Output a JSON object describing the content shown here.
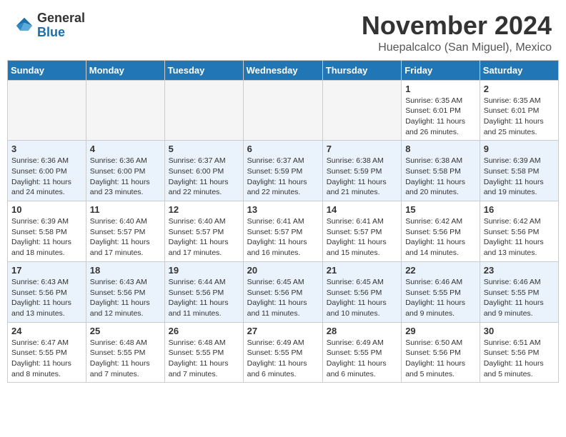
{
  "header": {
    "logo_general": "General",
    "logo_blue": "Blue",
    "month": "November 2024",
    "location": "Huepalcalco (San Miguel), Mexico"
  },
  "days_of_week": [
    "Sunday",
    "Monday",
    "Tuesday",
    "Wednesday",
    "Thursday",
    "Friday",
    "Saturday"
  ],
  "weeks": [
    [
      {
        "day": "",
        "info": ""
      },
      {
        "day": "",
        "info": ""
      },
      {
        "day": "",
        "info": ""
      },
      {
        "day": "",
        "info": ""
      },
      {
        "day": "",
        "info": ""
      },
      {
        "day": "1",
        "info": "Sunrise: 6:35 AM\nSunset: 6:01 PM\nDaylight: 11 hours and 26 minutes."
      },
      {
        "day": "2",
        "info": "Sunrise: 6:35 AM\nSunset: 6:01 PM\nDaylight: 11 hours and 25 minutes."
      }
    ],
    [
      {
        "day": "3",
        "info": "Sunrise: 6:36 AM\nSunset: 6:00 PM\nDaylight: 11 hours and 24 minutes."
      },
      {
        "day": "4",
        "info": "Sunrise: 6:36 AM\nSunset: 6:00 PM\nDaylight: 11 hours and 23 minutes."
      },
      {
        "day": "5",
        "info": "Sunrise: 6:37 AM\nSunset: 6:00 PM\nDaylight: 11 hours and 22 minutes."
      },
      {
        "day": "6",
        "info": "Sunrise: 6:37 AM\nSunset: 5:59 PM\nDaylight: 11 hours and 22 minutes."
      },
      {
        "day": "7",
        "info": "Sunrise: 6:38 AM\nSunset: 5:59 PM\nDaylight: 11 hours and 21 minutes."
      },
      {
        "day": "8",
        "info": "Sunrise: 6:38 AM\nSunset: 5:58 PM\nDaylight: 11 hours and 20 minutes."
      },
      {
        "day": "9",
        "info": "Sunrise: 6:39 AM\nSunset: 5:58 PM\nDaylight: 11 hours and 19 minutes."
      }
    ],
    [
      {
        "day": "10",
        "info": "Sunrise: 6:39 AM\nSunset: 5:58 PM\nDaylight: 11 hours and 18 minutes."
      },
      {
        "day": "11",
        "info": "Sunrise: 6:40 AM\nSunset: 5:57 PM\nDaylight: 11 hours and 17 minutes."
      },
      {
        "day": "12",
        "info": "Sunrise: 6:40 AM\nSunset: 5:57 PM\nDaylight: 11 hours and 17 minutes."
      },
      {
        "day": "13",
        "info": "Sunrise: 6:41 AM\nSunset: 5:57 PM\nDaylight: 11 hours and 16 minutes."
      },
      {
        "day": "14",
        "info": "Sunrise: 6:41 AM\nSunset: 5:57 PM\nDaylight: 11 hours and 15 minutes."
      },
      {
        "day": "15",
        "info": "Sunrise: 6:42 AM\nSunset: 5:56 PM\nDaylight: 11 hours and 14 minutes."
      },
      {
        "day": "16",
        "info": "Sunrise: 6:42 AM\nSunset: 5:56 PM\nDaylight: 11 hours and 13 minutes."
      }
    ],
    [
      {
        "day": "17",
        "info": "Sunrise: 6:43 AM\nSunset: 5:56 PM\nDaylight: 11 hours and 13 minutes."
      },
      {
        "day": "18",
        "info": "Sunrise: 6:43 AM\nSunset: 5:56 PM\nDaylight: 11 hours and 12 minutes."
      },
      {
        "day": "19",
        "info": "Sunrise: 6:44 AM\nSunset: 5:56 PM\nDaylight: 11 hours and 11 minutes."
      },
      {
        "day": "20",
        "info": "Sunrise: 6:45 AM\nSunset: 5:56 PM\nDaylight: 11 hours and 11 minutes."
      },
      {
        "day": "21",
        "info": "Sunrise: 6:45 AM\nSunset: 5:56 PM\nDaylight: 11 hours and 10 minutes."
      },
      {
        "day": "22",
        "info": "Sunrise: 6:46 AM\nSunset: 5:55 PM\nDaylight: 11 hours and 9 minutes."
      },
      {
        "day": "23",
        "info": "Sunrise: 6:46 AM\nSunset: 5:55 PM\nDaylight: 11 hours and 9 minutes."
      }
    ],
    [
      {
        "day": "24",
        "info": "Sunrise: 6:47 AM\nSunset: 5:55 PM\nDaylight: 11 hours and 8 minutes."
      },
      {
        "day": "25",
        "info": "Sunrise: 6:48 AM\nSunset: 5:55 PM\nDaylight: 11 hours and 7 minutes."
      },
      {
        "day": "26",
        "info": "Sunrise: 6:48 AM\nSunset: 5:55 PM\nDaylight: 11 hours and 7 minutes."
      },
      {
        "day": "27",
        "info": "Sunrise: 6:49 AM\nSunset: 5:55 PM\nDaylight: 11 hours and 6 minutes."
      },
      {
        "day": "28",
        "info": "Sunrise: 6:49 AM\nSunset: 5:55 PM\nDaylight: 11 hours and 6 minutes."
      },
      {
        "day": "29",
        "info": "Sunrise: 6:50 AM\nSunset: 5:56 PM\nDaylight: 11 hours and 5 minutes."
      },
      {
        "day": "30",
        "info": "Sunrise: 6:51 AM\nSunset: 5:56 PM\nDaylight: 11 hours and 5 minutes."
      }
    ]
  ]
}
